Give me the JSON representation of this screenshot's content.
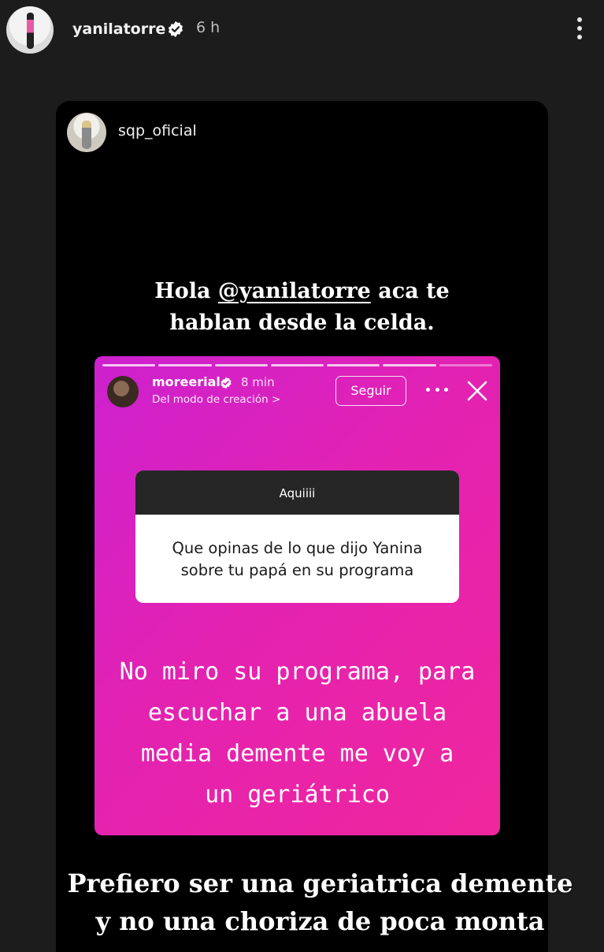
{
  "header": {
    "username": "yanilatorre",
    "time": "6 h",
    "verified_color": "#ffffff"
  },
  "reposted_story": {
    "username": "sqp_oficial",
    "caption_top_before": "Hola ",
    "caption_top_mention": "@yanilatorre",
    "caption_top_after": " aca te",
    "caption_top_line2": "hablan desde la celda.",
    "embedded": {
      "username": "moreerial",
      "time": "8 min",
      "subtitle": "Del modo de creación >",
      "follow_label": "Seguir",
      "question_title": "Aquiiii",
      "question_text_line1": "Que opinas de lo que dijo Yanina",
      "question_text_line2": "sobre tu papá en su programa",
      "answer_line1": "No miro su programa, para",
      "answer_line2": "escuchar a una abuela",
      "answer_line3": "media demente me voy a",
      "answer_line4": "un geriátrico",
      "gradient_colors": [
        "#cc21cf",
        "#e322b2",
        "#f0269c"
      ]
    }
  },
  "bottom_caption": {
    "line1": "Prefiero ser una geriatrica demente",
    "line2": "y no una choriza de poca monta"
  }
}
